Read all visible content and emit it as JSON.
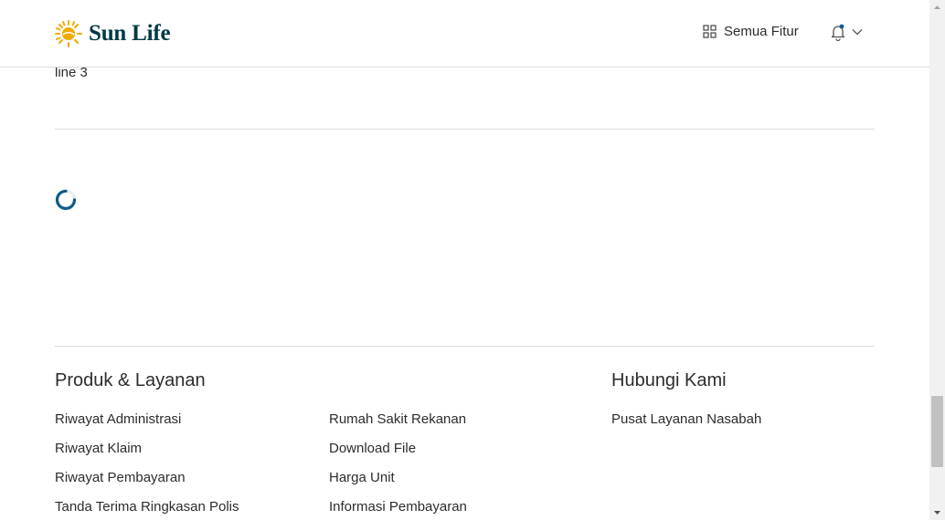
{
  "header": {
    "brand": "Sun Life",
    "features_label": "Semua Fitur",
    "icons": {
      "grid": "grid-icon",
      "bell": "bell-icon",
      "chevron": "chevron-down-icon"
    },
    "colors": {
      "brand_text": "#003946",
      "sun": "#f2a900",
      "bell_dot": "#0a5f9c"
    }
  },
  "content": {
    "line3": "line 3"
  },
  "footer": {
    "products_title": "Produk & Layanan",
    "contact_title": "Hubungi Kami",
    "products_col1": [
      "Riwayat Administrasi",
      "Riwayat Klaim",
      "Riwayat Pembayaran",
      "Tanda Terima Ringkasan Polis"
    ],
    "products_col2": [
      "Rumah Sakit Rekanan",
      "Download File",
      "Harga Unit",
      "Informasi Pembayaran"
    ],
    "contact_links": [
      "Pusat Layanan Nasabah"
    ]
  },
  "colors": {
    "spinner": "#0d5b8a"
  }
}
